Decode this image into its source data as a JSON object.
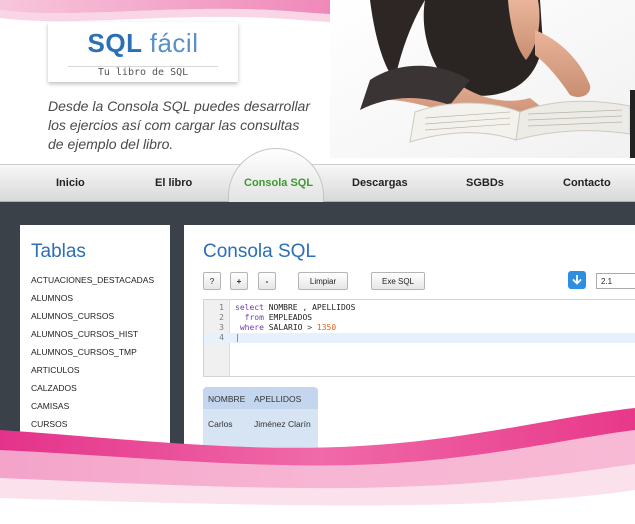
{
  "logo": {
    "title_bold": "SQL",
    "title_light": "fácil",
    "subtitle": "Tu libro de SQL"
  },
  "intro": {
    "line1": "Desde la Consola SQL puedes desarrollar",
    "line2": "los ejercios así com cargar las consultas",
    "line3": "de ejemplo del libro."
  },
  "nav": {
    "items": [
      {
        "label": "Inicio"
      },
      {
        "label": "El libro"
      },
      {
        "label": "Consola SQL"
      },
      {
        "label": "Descargas"
      },
      {
        "label": "SGBDs"
      },
      {
        "label": "Contacto"
      }
    ],
    "active": "Consola SQL"
  },
  "tables": {
    "heading": "Tablas",
    "items": [
      "ACTUACIONES_DESTACADAS",
      "ALUMNOS",
      "ALUMNOS_CURSOS",
      "ALUMNOS_CURSOS_HIST",
      "ALUMNOS_CURSOS_TMP",
      "ARTICULOS",
      "CALZADOS",
      "CAMISAS",
      "CURSOS"
    ]
  },
  "console": {
    "heading": "Consola SQL",
    "buttons": {
      "help": "?",
      "plus": "+",
      "minus": "-",
      "clear": "Limpiar",
      "exec": "Exe SQL"
    },
    "version_value": "2.1",
    "editor": {
      "line_numbers": [
        "1",
        "2",
        "3",
        "4"
      ],
      "line1": {
        "kw": "select",
        "rest": " NOMBRE , APELLIDOS"
      },
      "line2": {
        "indent": "  ",
        "kw": "from",
        "rest": " EMPLEADOS"
      },
      "line3": {
        "indent": " ",
        "kw": "where",
        "rest": " SALARIO ",
        "op": ">",
        "num": " 1350"
      }
    },
    "results": {
      "columns": [
        "NOMBRE",
        "APELLIDOS"
      ],
      "rows": [
        [
          "Carlos",
          "Jiménez Clarín"
        ]
      ]
    }
  },
  "colors": {
    "brand_blue": "#2a6fb8",
    "active_green": "#3c9a2e",
    "dark_bg": "#3b4149",
    "accent_pink": "#e8388a"
  }
}
